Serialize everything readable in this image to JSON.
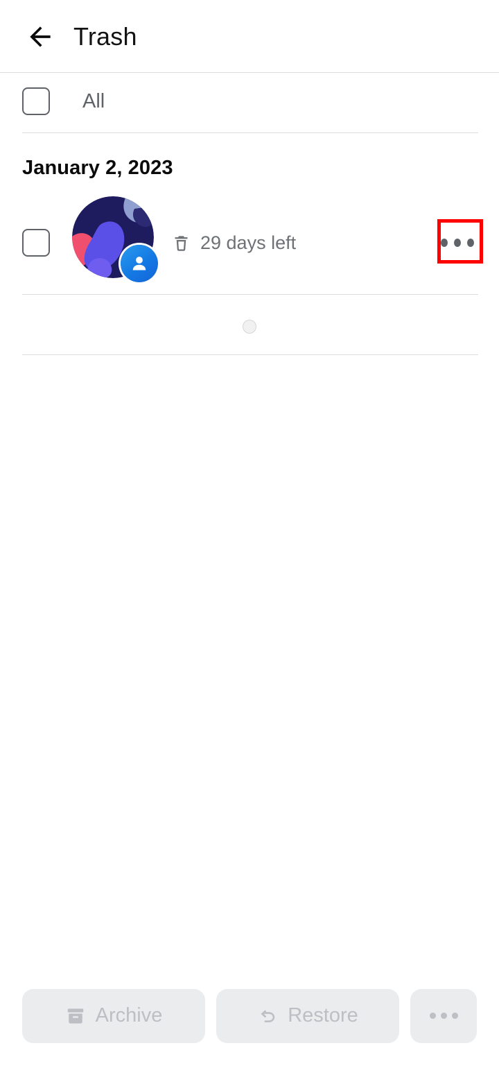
{
  "header": {
    "title": "Trash",
    "back_icon": "arrow-left-icon"
  },
  "select_all": {
    "label": "All",
    "checked": false
  },
  "groups": [
    {
      "date_label": "January 2, 2023",
      "items": [
        {
          "checked": false,
          "avatar": "photo-thumbnail",
          "badge_icon": "person-icon",
          "status_icon": "trash-icon",
          "status_text": "29 days left",
          "more_icon": "more-horizontal-icon",
          "highlighted": true
        }
      ]
    }
  ],
  "loading": {
    "indicator": "spinner-icon"
  },
  "bottom_bar": {
    "archive": {
      "label": "Archive",
      "icon": "archive-icon",
      "disabled": true
    },
    "restore": {
      "label": "Restore",
      "icon": "undo-icon",
      "disabled": true
    },
    "more": {
      "icon": "more-horizontal-icon",
      "disabled": true
    }
  },
  "colors": {
    "highlight": "#ff0000",
    "accent_blue": "#1479e3",
    "text_primary": "#131314",
    "text_secondary": "#5f6368",
    "divider": "#dadce0",
    "disabled_bg": "#ebecee",
    "disabled_fg": "#bcbfc4",
    "avatar_navy": "#1e1c5e",
    "avatar_pink": "#f0506e",
    "avatar_purple": "#5a50e8",
    "avatar_steel": "#8e9fd0"
  }
}
